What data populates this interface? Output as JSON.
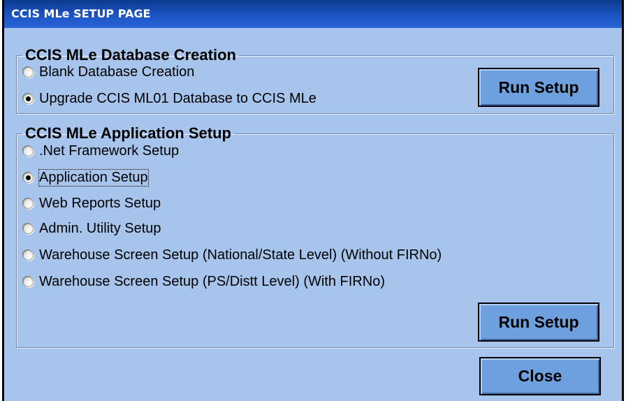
{
  "window": {
    "title": "CCIS MLe SETUP PAGE"
  },
  "database_group": {
    "legend": "CCIS MLe Database Creation",
    "options": [
      {
        "label": "Blank Database Creation",
        "checked": false
      },
      {
        "label": "Upgrade CCIS ML01 Database to CCIS MLe",
        "checked": true
      }
    ],
    "run_label": "Run Setup"
  },
  "application_group": {
    "legend": "CCIS MLe Application Setup",
    "options": [
      {
        "label": ".Net Framework Setup",
        "checked": false
      },
      {
        "label": "Application Setup",
        "checked": true
      },
      {
        "label": "Web Reports Setup",
        "checked": false
      },
      {
        "label": "Admin. Utility Setup",
        "checked": false
      },
      {
        "label": "Warehouse Screen Setup (National/State Level) (Without FIRNo)",
        "checked": false
      },
      {
        "label": "Warehouse Screen Setup (PS/Distt Level) (With FIRNo)",
        "checked": false
      }
    ],
    "run_label": "Run Setup"
  },
  "close_label": "Close"
}
